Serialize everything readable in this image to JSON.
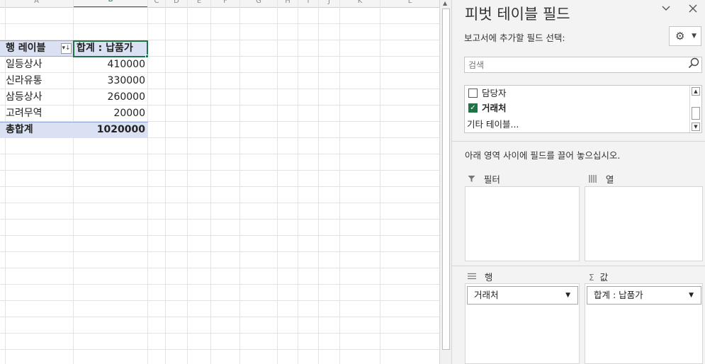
{
  "sheet": {
    "columns": [
      "A",
      "B",
      "C",
      "D",
      "E",
      "F",
      "G",
      "H",
      "I",
      "J",
      "K",
      "L"
    ],
    "pivot": {
      "row_header": "행 레이블",
      "value_header": "합계 : 납품가",
      "filter_glyph": "▾↓",
      "rows": [
        {
          "label": "일등상사",
          "value": "410000"
        },
        {
          "label": "신라유통",
          "value": "330000"
        },
        {
          "label": "삼등상사",
          "value": "260000"
        },
        {
          "label": "고려무역",
          "value": "20000"
        }
      ],
      "total": {
        "label": "총합계",
        "value": "1020000"
      }
    }
  },
  "pane": {
    "title": "피벗 테이블 필드",
    "subtitle": "보고서에 추가할 필드 선택:",
    "search_placeholder": "검색",
    "fields": [
      {
        "label": "담당자",
        "checked": false
      },
      {
        "label": "거래처",
        "checked": true
      }
    ],
    "more_tables": "기타 테이블...",
    "drag_hint": "아래 영역 사이에 필드를 끌어 놓으십시오.",
    "areas": {
      "filter": {
        "label": "필터"
      },
      "columns": {
        "label": "열"
      },
      "rows": {
        "label": "행",
        "item": "거래처"
      },
      "values": {
        "label": "값",
        "item": "합계 : 납품가"
      }
    }
  },
  "icons": {
    "chevron": "chevron-down-icon",
    "close": "close-icon",
    "gear": "gear-icon",
    "search": "search-icon",
    "filter": "filter-icon",
    "columns": "columns-icon",
    "rows": "rows-icon",
    "sigma": "sigma-icon"
  },
  "colors": {
    "accent": "#217346",
    "pivot_header_fill": "#d9e1f2",
    "pane_bg": "#f3f3f3"
  }
}
